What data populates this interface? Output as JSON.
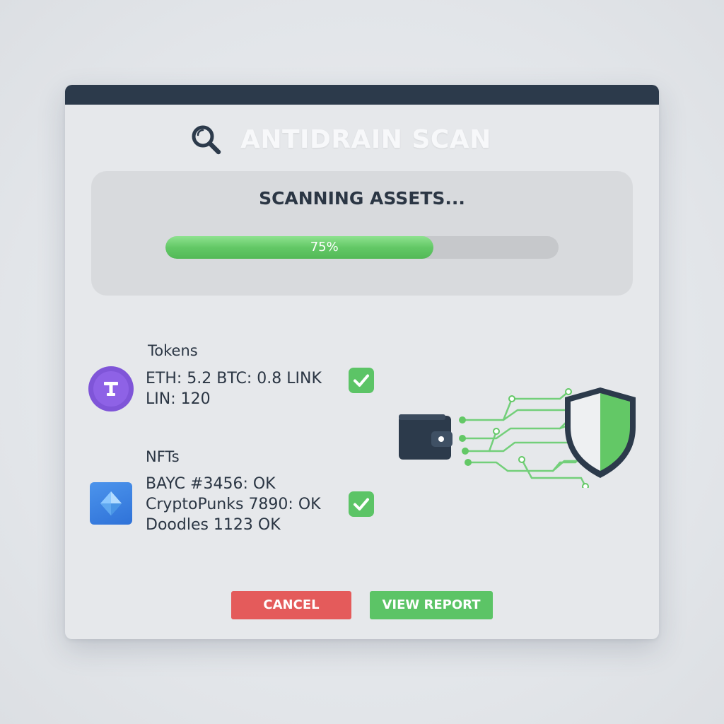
{
  "app": {
    "title": "ANTIDRAIN SCAN",
    "header_icon": "search-icon"
  },
  "scan": {
    "status": "SCANNING ASSETS...",
    "progress_percent": 75,
    "progress_label": "75%"
  },
  "sections": {
    "tokens": {
      "title": "Tokens",
      "icon": "token-logo-icon",
      "lines": [
        "ETH: 5.2 BTC: 0.8 LINK",
        "LIN: 120"
      ],
      "status_icon": "check-icon"
    },
    "nfts": {
      "title": "NFTs",
      "icon": "nft-diamond-icon",
      "lines": [
        "BAYC #3456: OK",
        "CryptoPunks 7890: OK",
        "Doodles 1123 OK"
      ],
      "status_icon": "check-icon"
    }
  },
  "illustration": {
    "icons": [
      "wallet-icon",
      "circuit-lines-icon",
      "shield-icon"
    ]
  },
  "buttons": {
    "cancel": "CANCEL",
    "view_report": "VIEW REPORT"
  },
  "colors": {
    "titlebar": "#2c3a4b",
    "progress": "#5cc466",
    "cancel": "#e45b5b",
    "confirm": "#5cc466",
    "token_logo": "#7f55d8",
    "nft_logo": "#3a80e0"
  }
}
